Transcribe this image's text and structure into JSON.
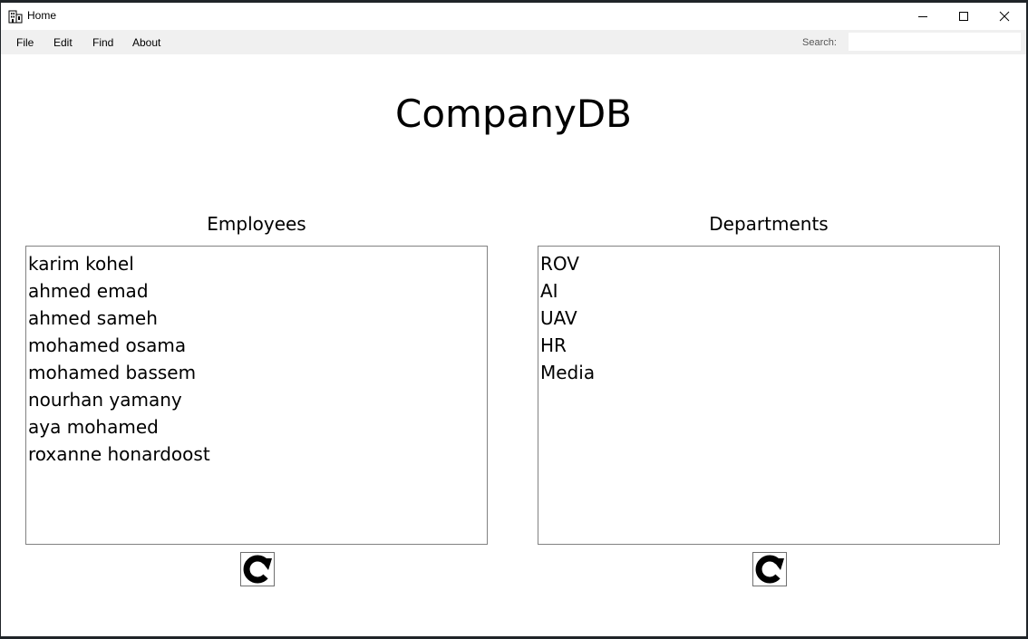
{
  "window": {
    "title": "Home",
    "icon": "building-icon"
  },
  "menu": {
    "items": [
      "File",
      "Edit",
      "Find",
      "About"
    ],
    "search_label": "Search:",
    "search_value": "",
    "search_placeholder": ""
  },
  "main": {
    "title": "CompanyDB",
    "employees": {
      "label": "Employees",
      "items": [
        "karim kohel",
        "ahmed emad",
        "ahmed sameh",
        "mohamed osama",
        "mohamed bassem",
        "nourhan yamany",
        "aya mohamed",
        "roxanne honardoost"
      ],
      "refresh_icon": "refresh-icon"
    },
    "departments": {
      "label": "Departments",
      "items": [
        "ROV",
        "AI",
        "UAV",
        "HR",
        "Media"
      ],
      "refresh_icon": "refresh-icon"
    }
  }
}
